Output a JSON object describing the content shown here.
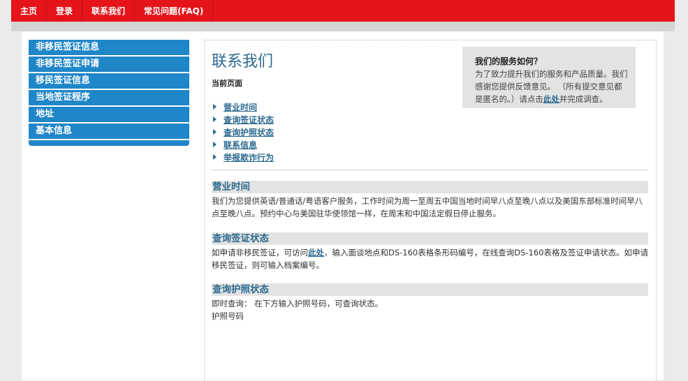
{
  "topnav": [
    "主页",
    "登录",
    "联系我们",
    "常见问题(FAQ)"
  ],
  "sidebar": {
    "items": [
      "非移民签证信息",
      "非移民签证申请",
      "移民签证信息",
      "当地签证程序",
      "地址",
      "基本信息"
    ]
  },
  "main": {
    "title": "联系我们",
    "current_page": "当前页面",
    "toc": [
      "营业时间",
      "查询签证状态",
      "查询护照状态",
      "联系信息",
      "举报欺诈行为"
    ],
    "service_box": {
      "title": "我们的服务如何？",
      "text": "为了致力提升我们的服务和产品质量。我们感谢您提供反馈意见。 （所有提交意见都是匿名的。）请点击",
      "link": "此处",
      "after": "并完成调查。"
    },
    "sections": [
      {
        "title": "营业时间",
        "body": "我们为您提供英语/普通话/粤语客户服务，工作时间为周一至周五中国当地时间早八点至晚八点以及美国东部标准时间早八点至晚八点。预约中心与美国驻华使领馆一样，在周末和中国法定假日停止服务。"
      },
      {
        "title": "查询签证状态",
        "body_before": "如申请非移民签证，可访问",
        "link": "此处",
        "body_after": "，输入面谈地点和DS-160表格条形码编号，在线查询DS-160表格及签证申请状态。如申请移民签证，则可输入档案编号。"
      },
      {
        "title": "查询护照状态",
        "body": "即时查询： 在下方输入护照号码，可查询状态。",
        "field_label": "护照号码"
      }
    ]
  },
  "colors": {
    "topbar": "#e5141b",
    "sidebar": "#1f86c8",
    "link": "#2c6a8f",
    "section_bg": "#e3e3e3"
  }
}
